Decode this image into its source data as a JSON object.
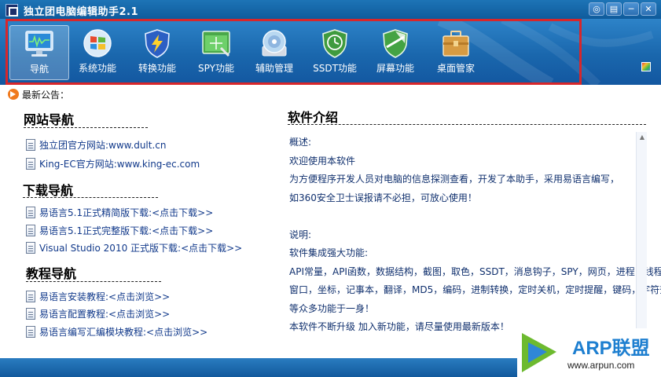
{
  "window": {
    "title": "独立团电脑编辑助手2.1",
    "buttons": [
      {
        "name": "skin-button",
        "glyph": "◎"
      },
      {
        "name": "menu-button",
        "glyph": "▤"
      },
      {
        "name": "minimize-button",
        "glyph": "─"
      },
      {
        "name": "close-button",
        "glyph": "✕"
      }
    ]
  },
  "toolbar": {
    "items": [
      {
        "label": "导航",
        "icon": "monitor-icon",
        "active": true
      },
      {
        "label": "系统功能",
        "icon": "windows-icon",
        "active": false
      },
      {
        "label": "转换功能",
        "icon": "shield-lightning-icon",
        "active": false
      },
      {
        "label": "SPY功能",
        "icon": "spy-window-icon",
        "active": false
      },
      {
        "label": "辅助管理",
        "icon": "disc-icon",
        "active": false
      },
      {
        "label": "SSDT功能",
        "icon": "shield-clock-icon",
        "active": false
      },
      {
        "label": "屏幕功能",
        "icon": "shield-icon",
        "active": false
      },
      {
        "label": "桌面管家",
        "icon": "toolbox-icon",
        "active": false
      }
    ]
  },
  "announcement": {
    "label": "最新公告："
  },
  "nav": {
    "website": {
      "title": "网站导航",
      "links": [
        {
          "text": "独立团官方网站:www.dult.cn"
        },
        {
          "text": "King-EC官方网站:www.king-ec.com"
        }
      ]
    },
    "download": {
      "title": "下载导航",
      "links": [
        {
          "text": "易语言5.1正式精简版下载:<点击下载>>"
        },
        {
          "text": "易语言5.1正式完整版下载:<点击下载>>"
        },
        {
          "text": "Visual Studio 2010 正式版下载:<点击下载>>"
        }
      ]
    },
    "tutorial": {
      "title": "教程导航",
      "links": [
        {
          "text": "易语言安装教程:<点击浏览>>"
        },
        {
          "text": "易语言配置教程:<点击浏览>>"
        },
        {
          "text": "易语言编写汇编模块教程:<点击浏览>>"
        }
      ]
    }
  },
  "intro": {
    "title": "软件介绍",
    "lines": [
      "概述:",
      "欢迎使用本软件",
      "为方便程序开发人员对电脑的信息探测查看，开发了本助手，采用易语言编写，",
      "如360安全卫士误报请不必担，可放心使用！",
      "",
      "说明:",
      "软件集成强大功能:",
      "API常量，API函数，数据结构，截图，取色，SSDT，消息钩子，SPY，网页，进程，线程，内核，",
      "窗口，坐标，记事本，翻译，MD5，编码，进制转换，定时关机，定时提醒，键码，字符查询",
      "等众多功能于一身！",
      "本软件不断升级 加入新功能，请尽量使用最新版本！"
    ]
  },
  "watermark": {
    "brand": "ARP联盟",
    "url": "www.arpun.com"
  }
}
